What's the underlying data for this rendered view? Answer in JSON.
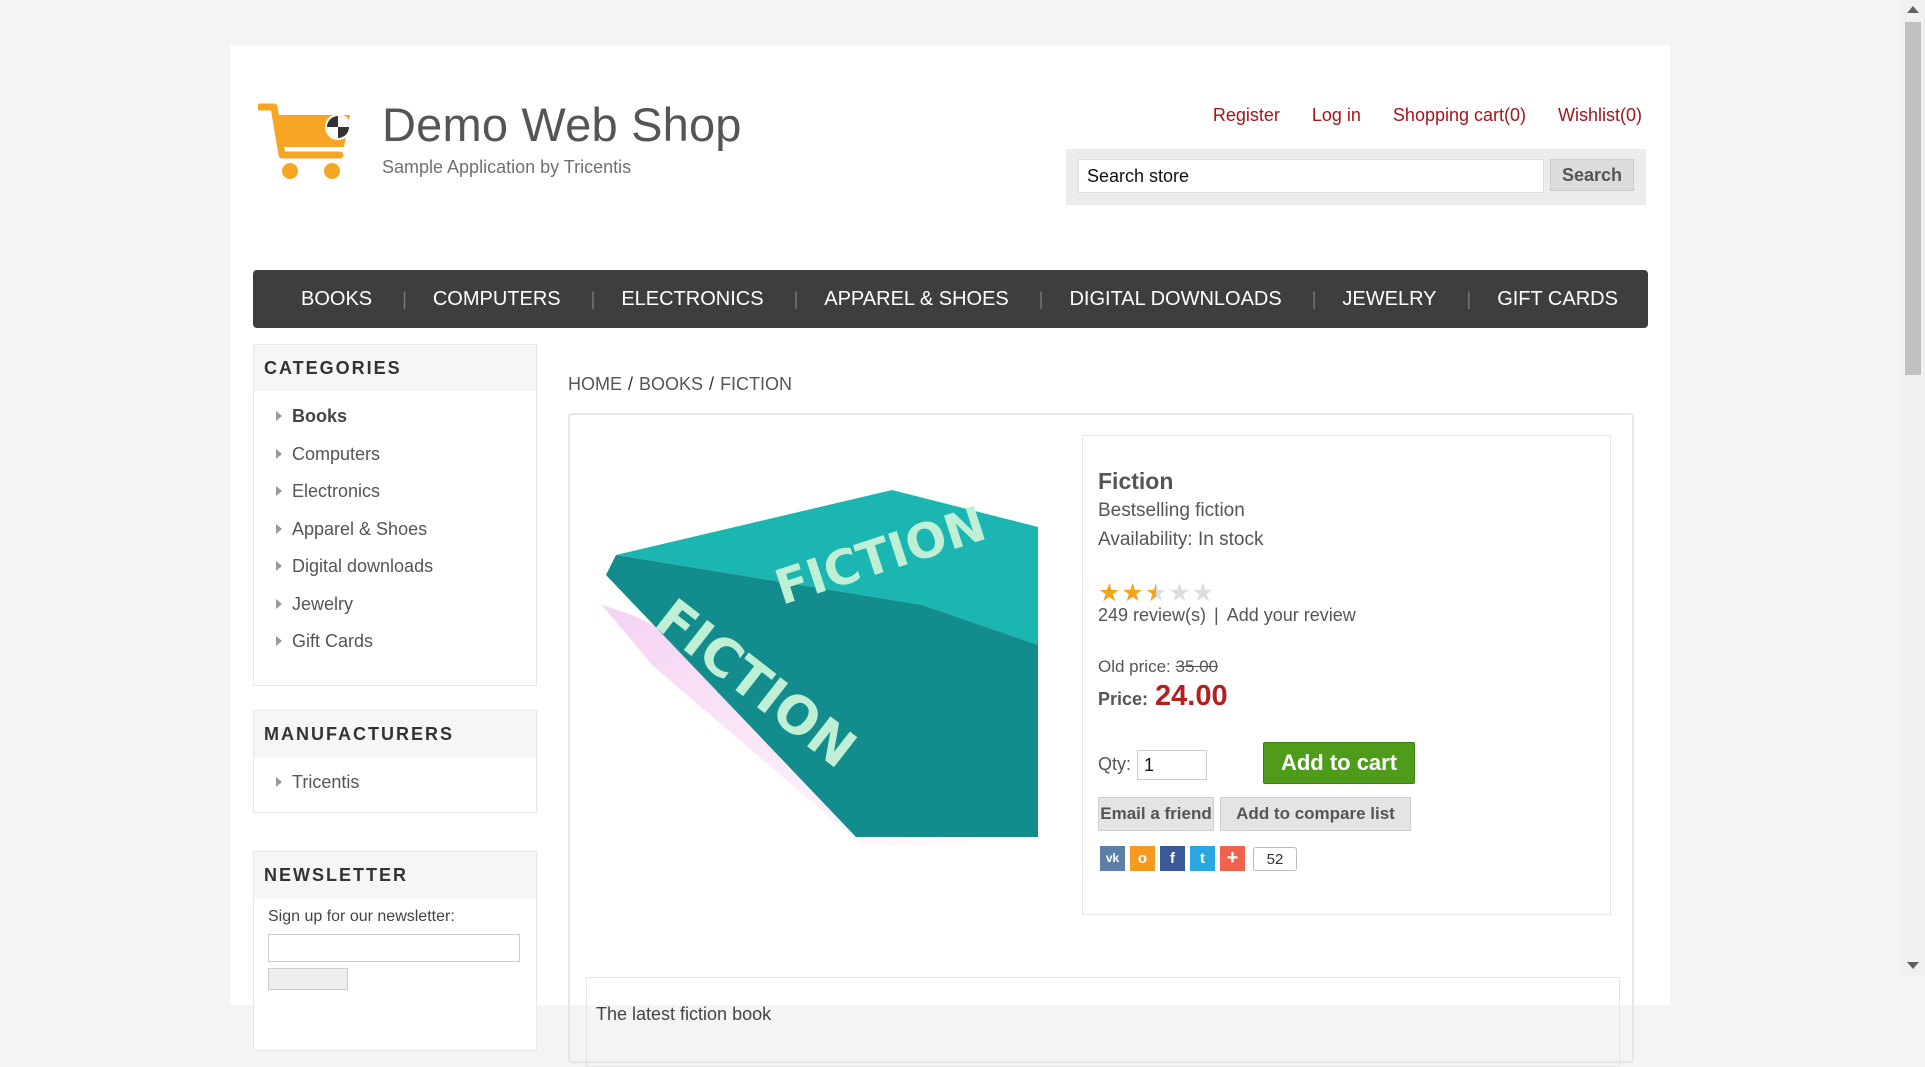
{
  "header": {
    "logo_title": "Demo Web Shop",
    "logo_subtitle": "Sample Application by Tricentis",
    "links": [
      "Register",
      "Log in",
      "Shopping cart(0)",
      "Wishlist(0)"
    ],
    "search": {
      "value": "Search store",
      "button": "Search"
    }
  },
  "nav": {
    "items": [
      "BOOKS",
      "COMPUTERS",
      "ELECTRONICS",
      "APPAREL & SHOES",
      "DIGITAL DOWNLOADS",
      "JEWELRY",
      "GIFT CARDS"
    ]
  },
  "sidebar": {
    "categories": {
      "title": "CATEGORIES",
      "items": [
        "Books",
        "Computers",
        "Electronics",
        "Apparel & Shoes",
        "Digital downloads",
        "Jewelry",
        "Gift Cards"
      ]
    },
    "manufacturers": {
      "title": "MANUFACTURERS",
      "items": [
        "Tricentis"
      ]
    },
    "newsletter": {
      "title": "NEWSLETTER",
      "text": "Sign up for our newsletter:"
    }
  },
  "breadcrumb": {
    "home": "HOME",
    "category": "BOOKS",
    "current": "FICTION",
    "separator": "/"
  },
  "product": {
    "name": "Fiction",
    "short_description": "Bestselling fiction",
    "availability": "Availability: In stock",
    "rating": 2.5,
    "rating_max": 5,
    "reviews_count": "249 review(s)",
    "add_review": "Add your review",
    "review_separator": "|",
    "old_price_label": "Old price:",
    "old_price": "35.00",
    "price_label": "Price:",
    "price": "24.00",
    "qty_label": "Qty:",
    "qty": "1",
    "add_to_cart": "Add to cart",
    "email_friend": "Email a friend",
    "add_compare": "Add to compare list",
    "share_count": "52",
    "image_text": "FICTION",
    "full_description": "The latest fiction book"
  },
  "colors": {
    "link_red": "#a3151c",
    "price_red": "#b41f1f",
    "nav_bg": "#3e3e3e",
    "cart_green": "#4e9c1a",
    "book_teal": "#17a5a5"
  }
}
